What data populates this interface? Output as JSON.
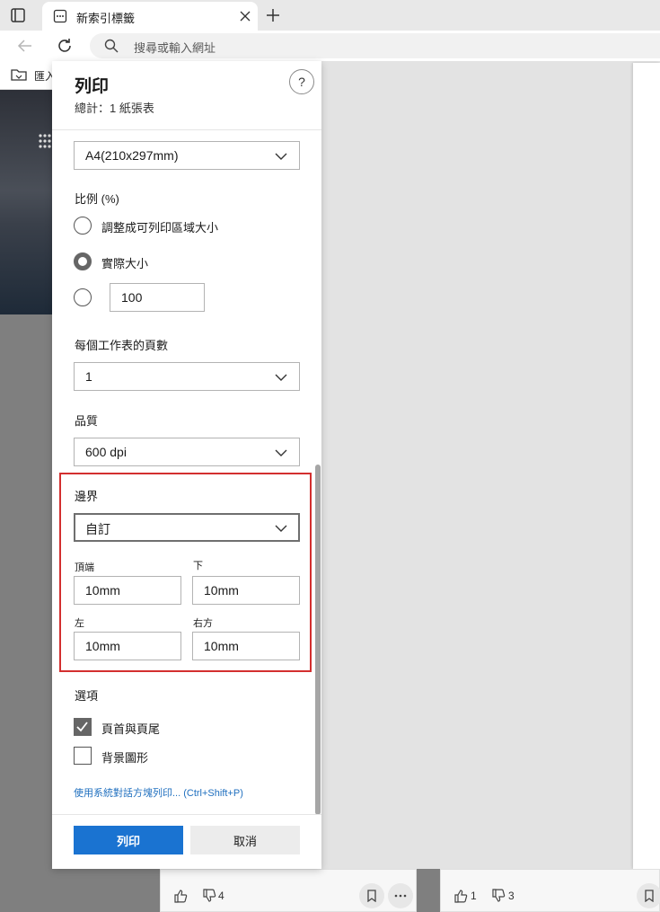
{
  "browser": {
    "tab_title": "新索引標籤",
    "address_placeholder": "搜尋或輸入網址",
    "favorites_label": "匯入"
  },
  "background_cards": {
    "card1_likes": "",
    "card1_dislikes": "4",
    "card2_likes": "1",
    "card2_dislikes": "3"
  },
  "dialog": {
    "title": "列印",
    "subtitle": "總計：1 紙張表",
    "help_label": "?",
    "paper_size": "A4(210x297mm)",
    "scale": {
      "label": "比例 (%)",
      "option_fit": "調整成可列印區域大小",
      "option_actual": "實際大小",
      "custom_value": "100"
    },
    "pages_per_sheet": {
      "label": "每個工作表的頁數",
      "value": "1"
    },
    "quality": {
      "label": "品質",
      "value": "600 dpi"
    },
    "margins": {
      "label": "邊界",
      "value": "自訂",
      "top_label": "頂端",
      "top_value": "10mm",
      "bottom_label": "下",
      "bottom_value": "10mm",
      "left_label": "左",
      "left_value": "10mm",
      "right_label": "右方",
      "right_value": "10mm"
    },
    "options": {
      "label": "選項",
      "headers_footers": "頁首與頁尾",
      "headers_footers_checked": true,
      "background_graphics": "背景圖形",
      "background_graphics_checked": false
    },
    "system_dialog_link": "使用系統對話方塊列印... (Ctrl+Shift+P)",
    "print_button": "列印",
    "cancel_button": "取消"
  },
  "colors": {
    "accent": "#1a73d1",
    "highlight_border": "#d32f2f",
    "link": "#1f6fbf"
  }
}
